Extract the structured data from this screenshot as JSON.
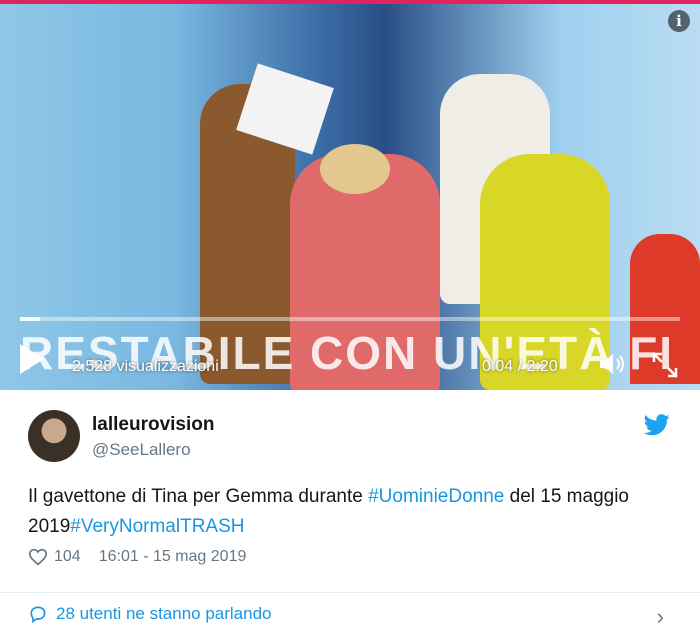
{
  "video": {
    "overlay_caption": "RESTABILE CON UN'ETÀ FI",
    "info_icon": "i",
    "views": "2.528 visualizzazioni",
    "time": "0:04 / 2:20",
    "progress_fraction": 0.03,
    "play_icon": "play-icon",
    "volume_icon": "volume-icon",
    "fullscreen_icon": "fullscreen-icon"
  },
  "tweet": {
    "display_name": "lalleurovision",
    "handle": "@SeeLallero",
    "text_parts": {
      "p1": "Il gavettone di Tina per Gemma durante ",
      "h1": "#UominieDonne",
      "p2": " del 15 maggio 2019",
      "h2": "#VeryNormalTRASH"
    },
    "likes": "104",
    "timestamp": "16:01 - 15 mag 2019",
    "talking": "28 utenti ne stanno parlando",
    "chevron": "›"
  },
  "colors": {
    "accent": "#1b95e0",
    "muted": "#657786",
    "top_line": "#e0245e"
  }
}
